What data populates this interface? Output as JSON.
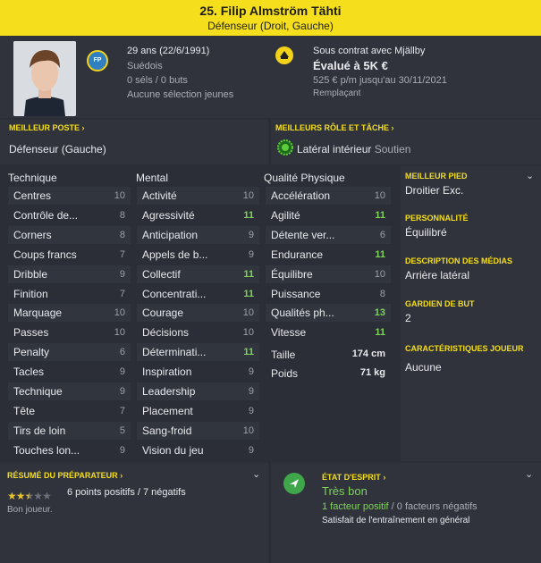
{
  "header": {
    "title": "25. Filip Almström Tähti",
    "subtitle": "Défenseur (Droit, Gauche)"
  },
  "profile": {
    "age": "29 ans (22/6/1991)",
    "nationality": "Suédois",
    "caps": "0 séls / 0 buts",
    "youth": "Aucune sélection jeunes",
    "badge": "FP"
  },
  "contract": {
    "club": "Sous contrat avec Mjällby",
    "value": "Évalué à 5K €",
    "wage": "525 € p/m jusqu'au 30/11/2021",
    "role": "Remplaçant"
  },
  "best_position": {
    "label": "MEILLEUR POSTE",
    "value": "Défenseur (Gauche)"
  },
  "best_role": {
    "label": "MEILLEURS RÔLE ET TÂCHE",
    "role": "Latéral intérieur",
    "duty": "Soutien"
  },
  "columns": {
    "technical": "Technique",
    "mental": "Mental",
    "physical": "Qualité Physique"
  },
  "technical": [
    [
      "Centres",
      "10"
    ],
    [
      "Contrôle de...",
      "8"
    ],
    [
      "Corners",
      "8"
    ],
    [
      "Coups francs",
      "7"
    ],
    [
      "Dribble",
      "9"
    ],
    [
      "Finition",
      "7"
    ],
    [
      "Marquage",
      "10"
    ],
    [
      "Passes",
      "10"
    ],
    [
      "Penalty",
      "6"
    ],
    [
      "Tacles",
      "9"
    ],
    [
      "Technique",
      "9"
    ],
    [
      "Tête",
      "7"
    ],
    [
      "Tirs de loin",
      "5"
    ],
    [
      "Touches lon...",
      "9"
    ]
  ],
  "mental": [
    [
      "Activité",
      "10"
    ],
    [
      "Agressivité",
      "11"
    ],
    [
      "Anticipation",
      "9"
    ],
    [
      "Appels de b...",
      "9"
    ],
    [
      "Collectif",
      "11"
    ],
    [
      "Concentrati...",
      "11"
    ],
    [
      "Courage",
      "10"
    ],
    [
      "Décisions",
      "10"
    ],
    [
      "Déterminati...",
      "11"
    ],
    [
      "Inspiration",
      "9"
    ],
    [
      "Leadership",
      "9"
    ],
    [
      "Placement",
      "9"
    ],
    [
      "Sang-froid",
      "10"
    ],
    [
      "Vision du jeu",
      "9"
    ]
  ],
  "physical": [
    [
      "Accélération",
      "10"
    ],
    [
      "Agilité",
      "11"
    ],
    [
      "Détente ver...",
      "6"
    ],
    [
      "Endurance",
      "11"
    ],
    [
      "Équilibre",
      "10"
    ],
    [
      "Puissance",
      "8"
    ],
    [
      "Qualités ph...",
      "13"
    ],
    [
      "Vitesse",
      "11"
    ]
  ],
  "measures": {
    "height_label": "Taille",
    "height": "174 cm",
    "weight_label": "Poids",
    "weight": "71 kg"
  },
  "side": {
    "foot_label": "MEILLEUR PIED",
    "foot": "Droitier Exc.",
    "pers_label": "PERSONNALITÉ",
    "pers": "Équilibré",
    "media_label": "DESCRIPTION DES MÉDIAS",
    "media": "Arrière latéral",
    "gk_label": "GARDIEN DE BUT",
    "gk": "2",
    "traits_label": "CARACTÉRISTIQUES JOUEUR",
    "traits": "Aucune"
  },
  "coach": {
    "label": "RÉSUMÉ DU PRÉPARATEUR",
    "summary": "6 points positifs / 7 négatifs",
    "note": "Bon joueur.",
    "stars": 2.5,
    "stars_max": 5
  },
  "morale": {
    "label": "ÉTAT D'ESPRIT",
    "state": "Très bon",
    "positive": "1 facteur positif",
    "sep": "/",
    "negative": "0 facteurs négatifs",
    "detail": "Satisfait de l'entraînement en général"
  },
  "colors": {
    "accent": "#f5df1c",
    "good": "#7fd35a",
    "bg": "#2b2e36",
    "panel": "#30333c"
  },
  "icons": {
    "chevron": "chevron-down-icon",
    "arrow": "chevron-right-icon",
    "club": "club-crest-icon",
    "role": "role-icon",
    "morale": "morale-arrow-icon",
    "star": "star-icon"
  }
}
